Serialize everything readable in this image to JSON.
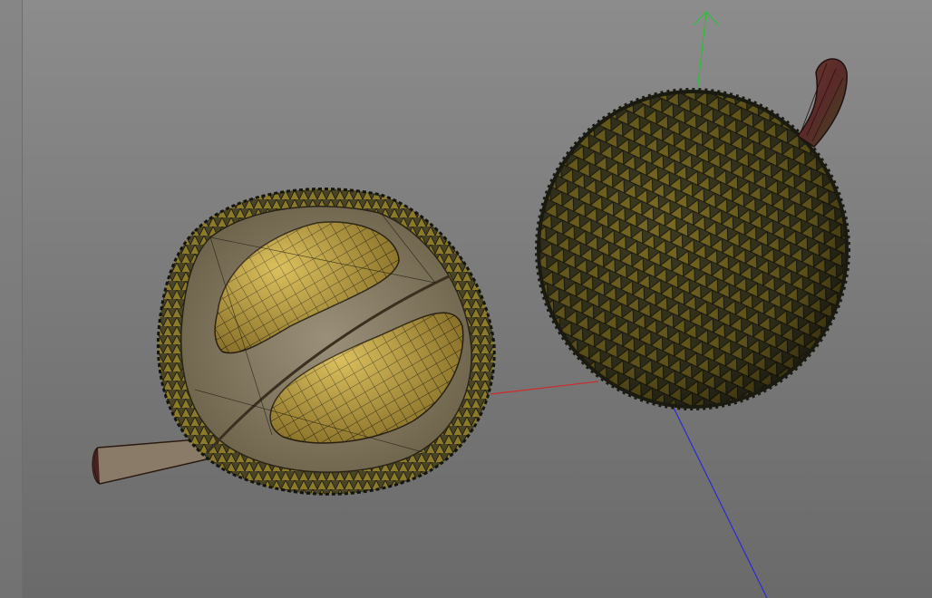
{
  "viewport": {
    "background_top": "#8c8c8c",
    "background_bottom": "#6a6a6a"
  },
  "axes": {
    "x_color": "#d02a2a",
    "y_color": "#2bbf3a",
    "z_color": "#2b2bd8"
  },
  "objects": [
    {
      "name": "durian-open-half",
      "icon": "open-durian-mesh"
    },
    {
      "name": "durian-whole",
      "icon": "whole-durian-mesh"
    }
  ]
}
